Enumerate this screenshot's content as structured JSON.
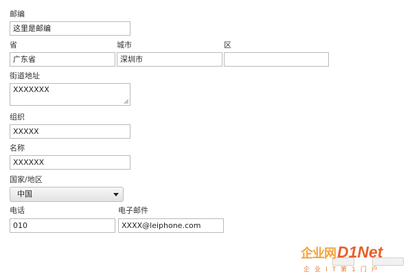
{
  "form": {
    "postal": {
      "label": "邮编",
      "value": "这里是邮编"
    },
    "province": {
      "label": "省",
      "value": "广东省"
    },
    "city": {
      "label": "城市",
      "value": "深圳市"
    },
    "district": {
      "label": "区",
      "value": ""
    },
    "street": {
      "label": "街道地址",
      "value": "XXXXXXX"
    },
    "organization": {
      "label": "组织",
      "value": "XXXXX"
    },
    "name": {
      "label": "名称",
      "value": "XXXXXX"
    },
    "country": {
      "label": "国家/地区",
      "selected": "中国"
    },
    "phone": {
      "label": "电话",
      "value": "010"
    },
    "email": {
      "label": "电子邮件",
      "value": "XXXX@leiphone.com"
    }
  },
  "watermark": {
    "brand_cn": "企业网",
    "brand_en": "D1Net",
    "tagline": "企业IT第1门户",
    "colors": {
      "orange": "#f2a33a",
      "red": "#e8602c"
    }
  }
}
